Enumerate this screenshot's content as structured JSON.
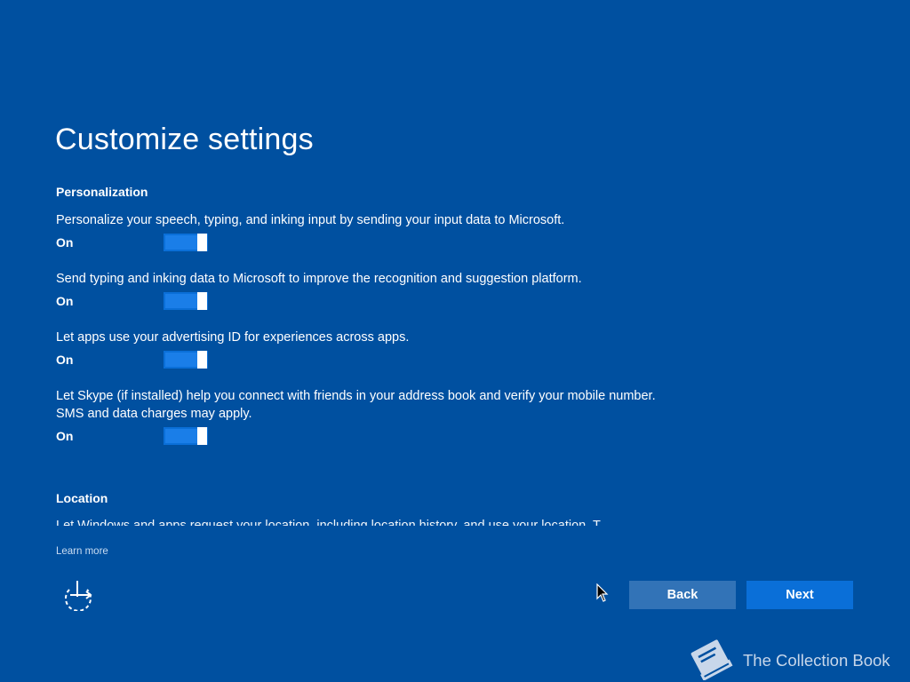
{
  "page": {
    "title": "Customize settings"
  },
  "sections": {
    "personalization": {
      "heading": "Personalization",
      "settings": [
        {
          "description": "Personalize your speech, typing, and inking input by sending your input data to Microsoft.",
          "state_label": "On",
          "enabled": true
        },
        {
          "description": "Send typing and inking data to Microsoft to improve the recognition and suggestion platform.",
          "state_label": "On",
          "enabled": true
        },
        {
          "description": "Let apps use your advertising ID for experiences across apps.",
          "state_label": "On",
          "enabled": true
        },
        {
          "description": "Let Skype (if installed) help you connect with friends in your address book and verify your mobile number. SMS and data charges may apply.",
          "state_label": "On",
          "enabled": true
        }
      ]
    },
    "location": {
      "heading": "Location",
      "partial_text": "Let Windows and apps request your location, including location history, and use your location. T"
    }
  },
  "footer": {
    "learn_more": "Learn more",
    "ease_of_access_icon": "ease-of-access-icon",
    "back_label": "Back",
    "next_label": "Next"
  },
  "watermark": {
    "text": "The Collection Book",
    "icon": "book-icon"
  },
  "colors": {
    "background": "#0050a0",
    "toggle_on": "#1a7ee8",
    "back_button": "#3273b7",
    "next_button": "#0a6fd8"
  }
}
